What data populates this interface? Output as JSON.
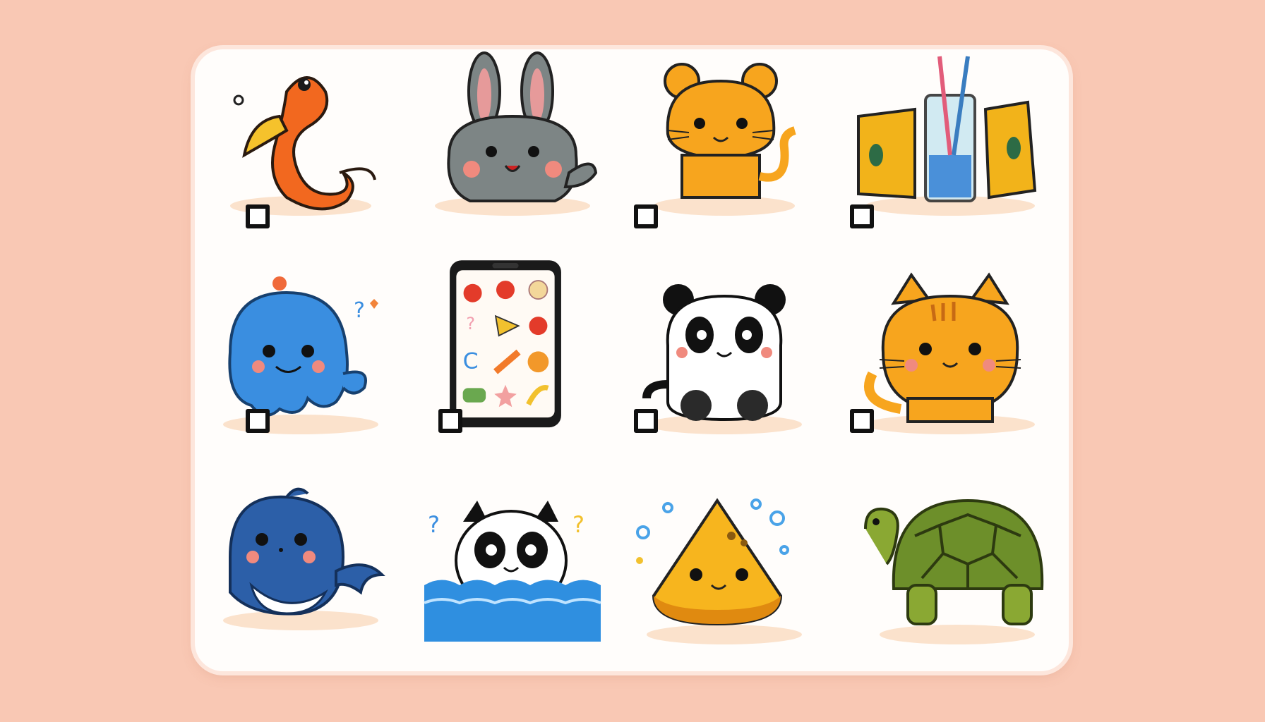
{
  "grid": {
    "tiles": [
      {
        "icon": "orange-seahorse-icon"
      },
      {
        "icon": "gray-bunny-icon"
      },
      {
        "icon": "orange-tiger-cub-icon"
      },
      {
        "icon": "cheese-blocks-and-glass-icon"
      },
      {
        "icon": "blue-octopus-icon"
      },
      {
        "icon": "phone-with-fruit-stickers-icon"
      },
      {
        "icon": "sitting-panda-icon"
      },
      {
        "icon": "orange-kitten-icon"
      },
      {
        "icon": "blue-whale-icon"
      },
      {
        "icon": "panda-in-water-icon"
      },
      {
        "icon": "cheese-slice-icon"
      },
      {
        "icon": "green-turtle-icon"
      }
    ],
    "checkboxes_checked": [
      false,
      false,
      false,
      false,
      false,
      false,
      false,
      false
    ]
  },
  "colors": {
    "page_background": "#f9c8b4",
    "card_background": "#fffdfb",
    "checkbox_border": "#111111"
  }
}
